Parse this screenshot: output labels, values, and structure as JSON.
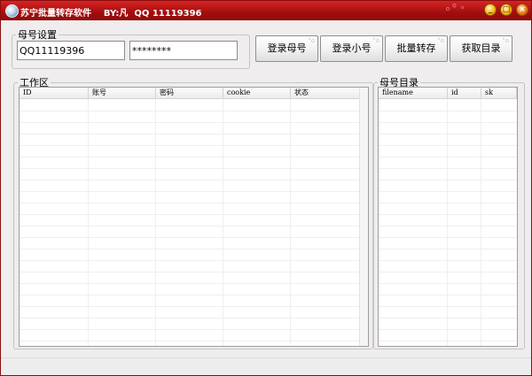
{
  "window": {
    "title": "苏宁批量转存软件    BY:凡  QQ 11119396",
    "minimize_glyph": "_",
    "maximize_glyph": "□",
    "close_glyph": "×"
  },
  "account_settings": {
    "legend": "母号设置",
    "qq_value": "QQ11119396",
    "password_value": "********"
  },
  "toolbar": {
    "login_master": "登录母号",
    "login_sub": "登录小号",
    "batch_transfer": "批量转存",
    "fetch_directory": "获取目录"
  },
  "workspace": {
    "legend": "工作区",
    "columns": [
      "ID",
      "账号",
      "密码",
      "cookie",
      "状态"
    ]
  },
  "master_directory": {
    "legend": "母号目录",
    "columns": [
      "filename",
      "id",
      "sk"
    ]
  },
  "icons": {
    "app": "app-globe-icon",
    "title_decoration": "bubble-decoration-icon"
  },
  "colors": {
    "titlebar": "#b31616",
    "window_bg": "#efeded",
    "button_accent": "#f5b814"
  }
}
